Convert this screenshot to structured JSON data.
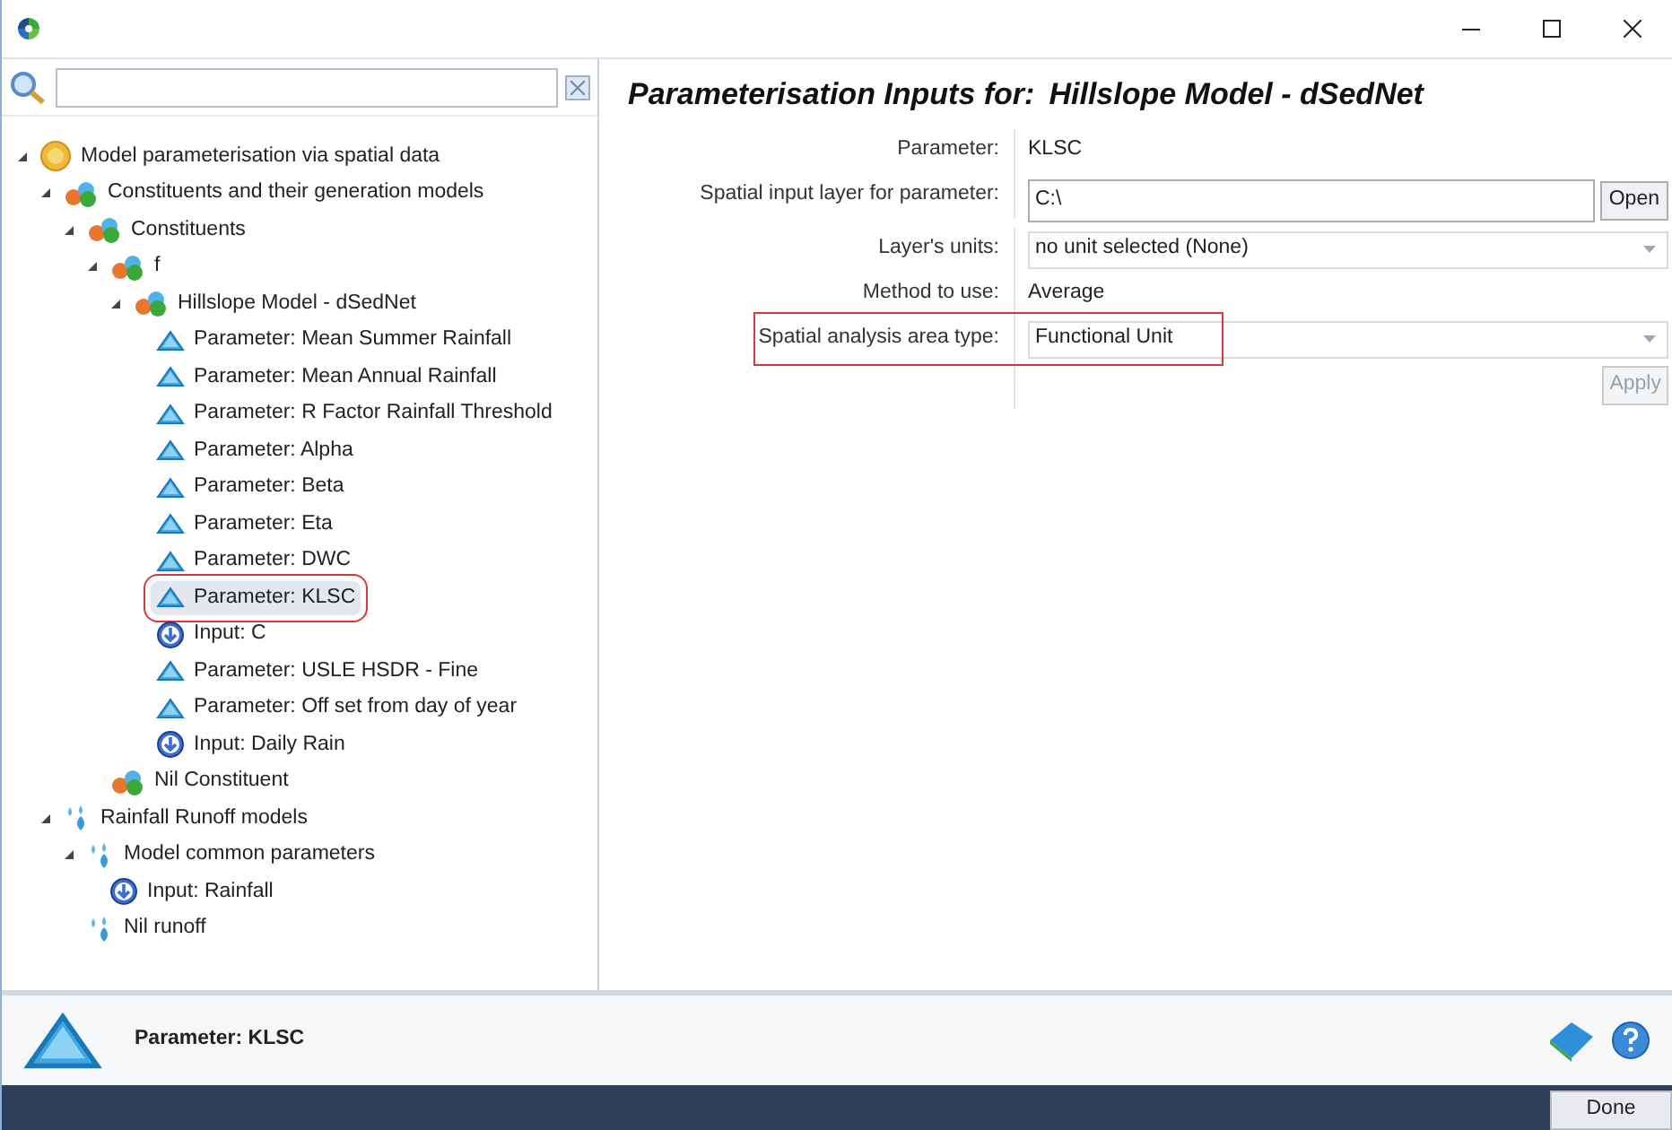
{
  "tree": [
    {
      "label": "Model parameterisation via spatial data",
      "kind": "root",
      "expanded": true,
      "selected": false,
      "children": [
        {
          "label": "Constituents and their generation models",
          "kind": "constituent",
          "expanded": true,
          "selected": false,
          "children": [
            {
              "label": "Constituents",
              "kind": "constituent",
              "expanded": true,
              "selected": false,
              "children": [
                {
                  "label": "f",
                  "kind": "constituent",
                  "expanded": true,
                  "selected": false,
                  "children": [
                    {
                      "label": "Hillslope Model - dSedNet",
                      "kind": "constituent",
                      "expanded": true,
                      "selected": false,
                      "children": [
                        {
                          "label": "Parameter: Mean Summer Rainfall",
                          "kind": "parameter",
                          "selected": false
                        },
                        {
                          "label": "Parameter: Mean Annual Rainfall",
                          "kind": "parameter",
                          "selected": false
                        },
                        {
                          "label": "Parameter: R Factor Rainfall Threshold",
                          "kind": "parameter",
                          "selected": false
                        },
                        {
                          "label": "Parameter: Alpha",
                          "kind": "parameter",
                          "selected": false
                        },
                        {
                          "label": "Parameter: Beta",
                          "kind": "parameter",
                          "selected": false
                        },
                        {
                          "label": "Parameter: Eta",
                          "kind": "parameter",
                          "selected": false
                        },
                        {
                          "label": "Parameter: DWC",
                          "kind": "parameter",
                          "selected": false
                        },
                        {
                          "label": "Parameter: KLSC",
                          "kind": "parameter",
                          "selected": true,
                          "annotated": true
                        },
                        {
                          "label": "Input: C",
                          "kind": "input",
                          "selected": false
                        },
                        {
                          "label": "Parameter: USLE HSDR - Fine",
                          "kind": "parameter",
                          "selected": false
                        },
                        {
                          "label": "Parameter: Off set from day of year",
                          "kind": "parameter",
                          "selected": false
                        },
                        {
                          "label": "Input: Daily Rain",
                          "kind": "input",
                          "selected": false
                        }
                      ]
                    }
                  ]
                },
                {
                  "label": "Nil Constituent",
                  "kind": "constituent",
                  "selected": false
                }
              ]
            }
          ]
        },
        {
          "label": "Rainfall Runoff models",
          "kind": "rain",
          "expanded": true,
          "selected": false,
          "children": [
            {
              "label": "Model common parameters",
              "kind": "rain",
              "expanded": true,
              "selected": false,
              "children": [
                {
                  "label": "Input: Rainfall",
                  "kind": "input",
                  "selected": false
                }
              ]
            },
            {
              "label": "Nil runoff",
              "kind": "rain",
              "selected": false
            }
          ]
        }
      ]
    }
  ],
  "panel": {
    "heading": "Parameterisation Inputs for:",
    "model": "Hillslope Model - dSedNet",
    "fields": [
      {
        "label": "Parameter:",
        "kind": "text",
        "value": "KLSC"
      },
      {
        "label": "Spatial input layer for parameter:",
        "kind": "file",
        "value": "C:\\",
        "button": "Open"
      },
      {
        "label": "Layer's units:",
        "kind": "dropdown",
        "value": "no unit selected (None)"
      },
      {
        "label": "Method to use:",
        "kind": "text",
        "value": "Average"
      },
      {
        "label": "Spatial analysis area type:",
        "kind": "dropdown",
        "value": "Functional Unit",
        "annotated": true
      }
    ],
    "apply": {
      "label": "Apply",
      "disabled": true
    }
  },
  "info_bar": {
    "label": "Parameter: KLSC"
  },
  "footer": {
    "done": "Done"
  }
}
